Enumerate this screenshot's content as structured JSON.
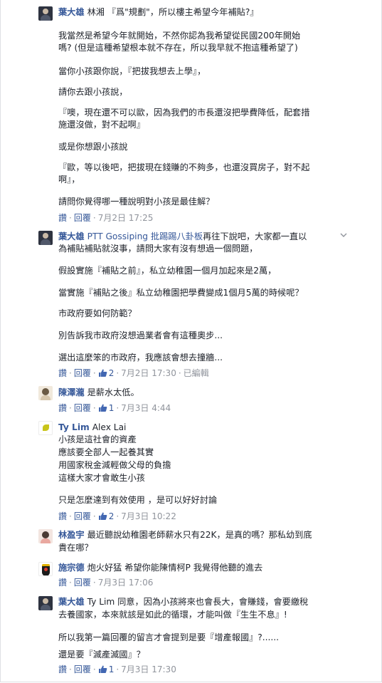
{
  "comments": [
    {
      "author": "葉大雄",
      "lines": [
        "林湘 『爲\"規劃\"，所以樓主希望今年補貼?』",
        "我當然是希望今年就開始，不然你認為我希望從民國200年開始",
        "嗎? (但是這種希望根本就不存在，所以我早就不抱這種希望了)",
        "當你小孩跟你說，『把拔我想去上學』，",
        "請你去跟小孩說，",
        "『噢，現在還不可以歐，因為我們的市長還沒把學費降低，配套措",
        "施還沒做，對不起啊』",
        "或是你想跟小孩說",
        "『歐，等以後吧，把拔現在錢賺的不夠多，也還沒買房子，對不起",
        "啊』，",
        "請問你覺得哪一種說明對小孩是最佳解？"
      ],
      "reply": "讚",
      "respond": "回覆",
      "time": "7月2日 17:25"
    },
    {
      "author": "葉大雄",
      "mention": "PTT Gossiping 批踢踢八卦板",
      "lines": [
        "再往下說吧，大家都一直以",
        "為補貼補貼就沒事，請問大家有沒有想過一個問題，",
        "假設實施『補貼之前』，私立幼稚園一個月加起來是2萬，",
        "當實施『補貼之後』私立幼稚園把學費變成1個月5萬的時候呢？",
        "市政府要如何防範？",
        "別告訴我市政府沒想過業者會有這種奧步...",
        "選出這麼笨的市政府，我應該會想去撞牆..."
      ],
      "reply": "讚",
      "respond": "回覆",
      "likes": "2",
      "time": "7月2日 17:30",
      "edited": "已編輯"
    },
    {
      "author": "陳澤瀧",
      "lines": [
        "是薪水太低。"
      ],
      "reply": "讚",
      "respond": "回覆",
      "likes": "1",
      "time": "7月3日 4:44"
    },
    {
      "author": "Ty Lim",
      "lines": [
        "Alex Lai",
        "小孩是這社會的資產",
        "應該要全部人一起養其實",
        "用國家稅金減輕做父母的負擔",
        "這樣大家才會敢生小孩",
        "只是怎麼達到有效使用 ，是可以好好討論"
      ],
      "reply": "讚",
      "respond": "回覆",
      "likes": "2",
      "time": "7月3日 10:22"
    },
    {
      "author": "林盈宇",
      "lines": [
        "最近聽說幼稚園老師薪水只有22K，是真的嗎？那私幼到底",
        "貴在哪？"
      ]
    },
    {
      "author": "施宗德",
      "lines": [
        "炮火好猛 希望你能陳情柯P 我覺得他聽的進去"
      ],
      "reply": "讚",
      "respond": "回覆",
      "time": "7月3日 17:06"
    },
    {
      "author": "葉大雄",
      "lines": [
        "Ty Lim 同意，因為小孩將來也會長大，會賺錢，會要繳稅",
        "去養國家，本來就該是如此的循環，才能叫做『生生不息』!",
        "所以我第一篇回覆的留言才會提到是要『增產報國』?......",
        "還是要『滅產滅國』？"
      ],
      "reply": "讚",
      "respond": "回覆",
      "likes": "1",
      "time": "7月3日 17:30"
    }
  ],
  "icons": {
    "like": "thumbs-up-icon",
    "more": "chevron-down-icon"
  },
  "colors": {
    "link": "#365899",
    "meta": "#90949c",
    "text": "#1d2129",
    "like": "#4267b2"
  }
}
